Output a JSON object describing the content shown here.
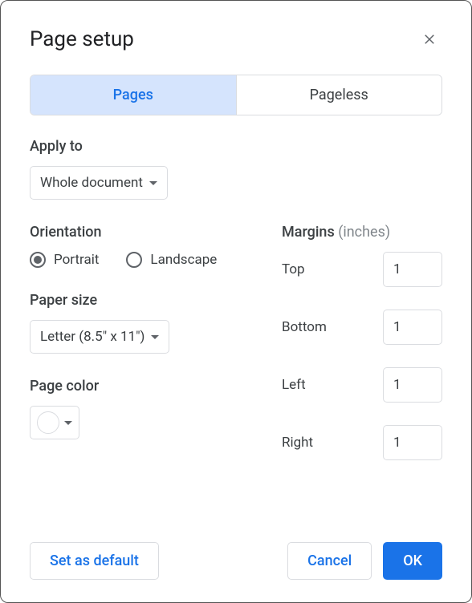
{
  "dialog": {
    "title": "Page setup"
  },
  "tabs": {
    "pages": "Pages",
    "pageless": "Pageless"
  },
  "applyTo": {
    "label": "Apply to",
    "value": "Whole document"
  },
  "orientation": {
    "label": "Orientation",
    "portrait": "Portrait",
    "landscape": "Landscape",
    "selected": "portrait"
  },
  "paperSize": {
    "label": "Paper size",
    "value": "Letter (8.5\" x 11\")"
  },
  "pageColor": {
    "label": "Page color",
    "value": "#ffffff"
  },
  "margins": {
    "label": "Margins",
    "hint": "(inches)",
    "top": {
      "label": "Top",
      "value": "1"
    },
    "bottom": {
      "label": "Bottom",
      "value": "1"
    },
    "left": {
      "label": "Left",
      "value": "1"
    },
    "right": {
      "label": "Right",
      "value": "1"
    }
  },
  "footer": {
    "setDefault": "Set as default",
    "cancel": "Cancel",
    "ok": "OK"
  }
}
